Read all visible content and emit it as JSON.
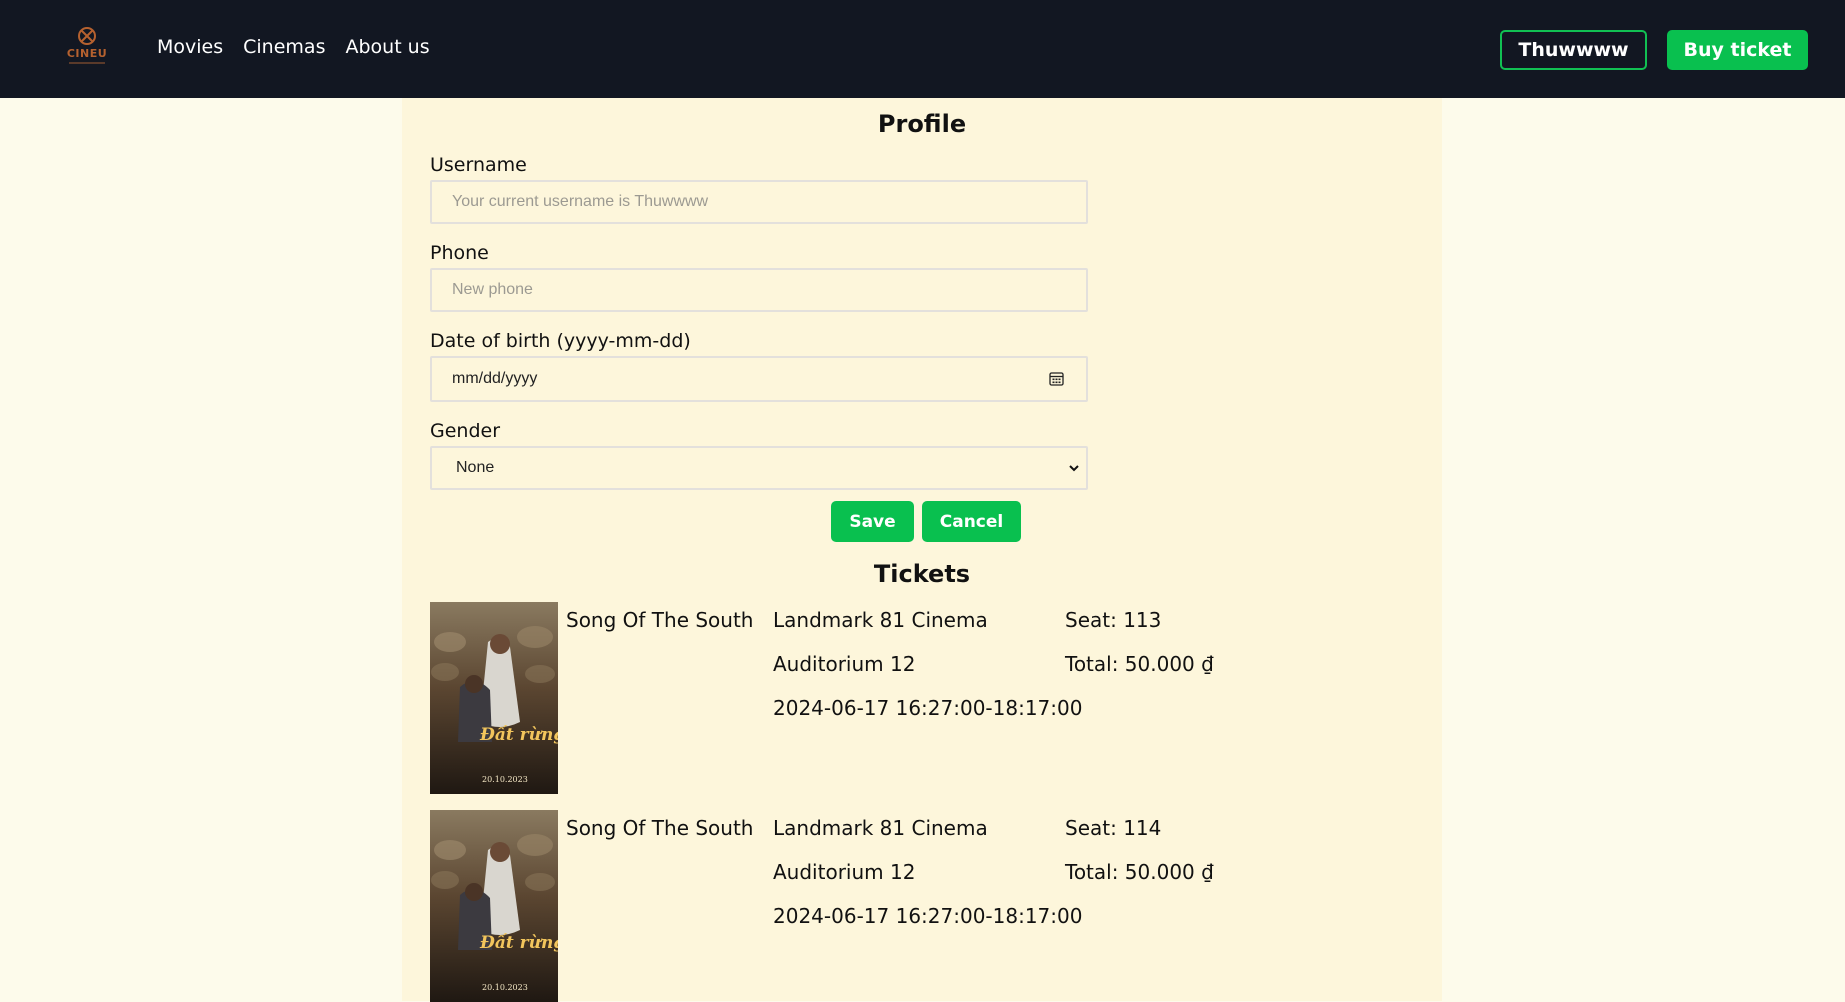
{
  "nav": {
    "logo_text": "CINEU",
    "links": [
      "Movies",
      "Cinemas",
      "About us"
    ],
    "user_button": "Thuwwww",
    "buy_button": "Buy ticket"
  },
  "profile": {
    "title": "Profile",
    "username_label": "Username",
    "username_placeholder": "Your current username is Thuwwww",
    "phone_label": "Phone",
    "phone_placeholder": "New phone",
    "dob_label": "Date of birth (yyyy-mm-dd)",
    "dob_placeholder": "mm/dd/yyyy",
    "gender_label": "Gender",
    "gender_value": "None",
    "save_label": "Save",
    "cancel_label": "Cancel"
  },
  "tickets": {
    "title": "Tickets",
    "items": [
      {
        "movie": "Song Of The South",
        "cinema": "Landmark 81 Cinema",
        "auditorium": "Auditorium 12",
        "showtime": "2024-06-17 16:27:00-18:17:00",
        "seat": "Seat: 113",
        "total": "Total: 50.000 ₫",
        "poster_title": "Đất rừng phương nam",
        "poster_date": "20.10.2023"
      },
      {
        "movie": "Song Of The South",
        "cinema": "Landmark 81 Cinema",
        "auditorium": "Auditorium 12",
        "showtime": "2024-06-17 16:27:00-18:17:00",
        "seat": "Seat: 114",
        "total": "Total: 50.000 ₫",
        "poster_title": "Đất rừng phương nam",
        "poster_date": "20.10.2023"
      }
    ]
  },
  "colors": {
    "nav_bg": "#121722",
    "accent_green": "#09c04f",
    "page_bg": "#fdfbeb",
    "content_bg": "#fdf6db"
  }
}
